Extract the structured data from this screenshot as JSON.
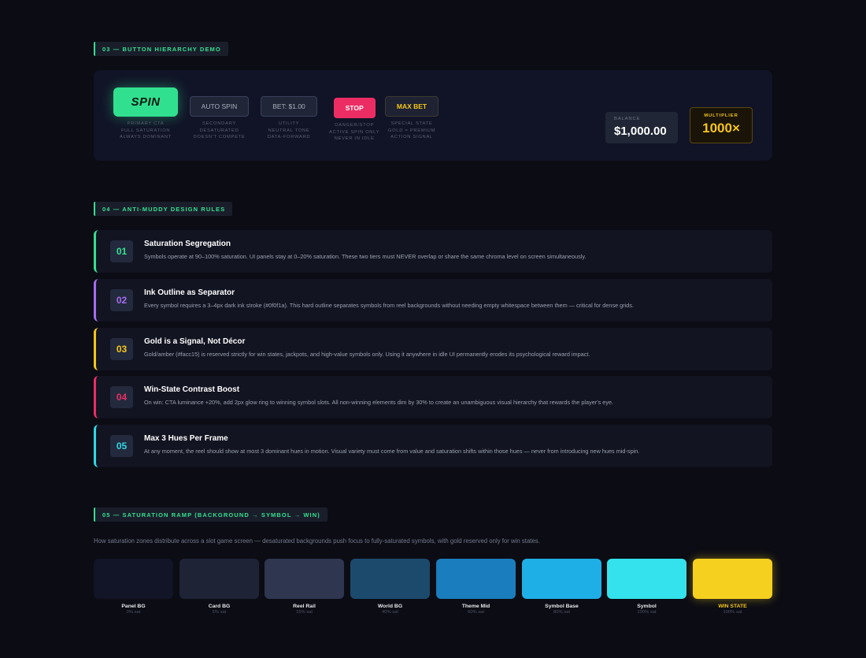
{
  "sections": {
    "buttons": "03 — BUTTON HIERARCHY DEMO",
    "rules": "04 — ANTI-MUDDY DESIGN RULES",
    "ramp": "05 — SATURATION RAMP (BACKGROUND → SYMBOL → WIN)"
  },
  "buttons": [
    {
      "label": "SPIN",
      "caption": [
        "PRIMARY CTA",
        "FULL SATURATION",
        "ALWAYS DOMINANT"
      ],
      "color": "#31e08f"
    },
    {
      "label": "AUTO SPIN",
      "caption": [
        "SECONDARY",
        "DESATURATED",
        "DOESN'T COMPETE"
      ],
      "color": "#202637"
    },
    {
      "label": "BET: $1.00",
      "caption": [
        "UTILITY",
        "NEUTRAL TONE",
        "DATA-FORWARD"
      ],
      "color": "#202637"
    },
    {
      "label": "STOP",
      "caption": [
        "DANGER/STOP",
        "ACTIVE SPIN ONLY",
        "NEVER IN IDLE"
      ],
      "color": "#eb2d64"
    },
    {
      "label": "MAX BET",
      "caption": [
        "SPECIAL STATE",
        "GOLD = PREMIUM",
        "ACTION SIGNAL"
      ],
      "color": "#f5c518"
    }
  ],
  "balance": {
    "label": "BALANCE",
    "value": "$1,000.00"
  },
  "multiplier": {
    "label": "MULTIPLIER",
    "value": "1000×"
  },
  "rules": [
    {
      "num": "01",
      "color": "#35e08f",
      "title": "Saturation Segregation",
      "desc": "Symbols operate at 90–100% saturation. UI panels stay at 0–20% saturation. These two tiers must NEVER overlap or share the same chroma level on screen simultaneously."
    },
    {
      "num": "02",
      "color": "#a66cf0",
      "title": "Ink Outline as Separator",
      "desc": "Every symbol requires a 3–4px dark ink stroke (#0f0f1a). This hard outline separates symbols from reel backgrounds without needing empty whitespace between them — critical for dense grids."
    },
    {
      "num": "03",
      "color": "#f5c518",
      "title": "Gold is a Signal, Not Décor",
      "desc": "Gold/amber (#facc15) is reserved strictly for win states, jackpots, and high-value symbols only. Using it anywhere in idle UI permanently erodes its psychological reward impact."
    },
    {
      "num": "04",
      "color": "#eb2d64",
      "title": "Win-State Contrast Boost",
      "desc": "On win: CTA luminance +20%, add 2px glow ring to winning symbol slots. All non-winning elements dim by 30% to create an unambiguous visual hierarchy that rewards the player's eye."
    },
    {
      "num": "05",
      "color": "#2dd8e6",
      "title": "Max 3 Hues Per Frame",
      "desc": "At any moment, the reel should show at most 3 dominant hues in motion. Visual variety must come from value and saturation shifts within those hues — never from introducing new hues mid-spin."
    }
  ],
  "ramp": {
    "description": "How saturation zones distribute across a slot game screen — desaturated backgrounds push focus to fully-saturated symbols, with gold reserved only for win states.",
    "swatches": [
      {
        "name": "Panel BG",
        "sat": "0% sat",
        "color": "#121427"
      },
      {
        "name": "Card BG",
        "sat": "5% sat",
        "color": "#1e2436"
      },
      {
        "name": "Reel Rail",
        "sat": "15% sat",
        "color": "#2e3650"
      },
      {
        "name": "World BG",
        "sat": "40% sat",
        "color": "#1c4a6c"
      },
      {
        "name": "Theme Mid",
        "sat": "60% sat",
        "color": "#1a7dbd"
      },
      {
        "name": "Symbol Base",
        "sat": "80% sat",
        "color": "#1eafe6"
      },
      {
        "name": "Symbol",
        "sat": "100% sat",
        "color": "#33e2ec"
      },
      {
        "name": "WIN STATE",
        "sat": "100% sat",
        "color": "#f5d01f"
      }
    ]
  }
}
